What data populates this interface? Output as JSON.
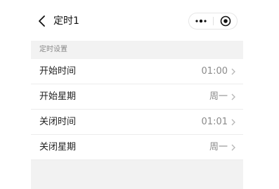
{
  "header": {
    "title": "定时1",
    "back_icon": "chevron-left-icon",
    "more_icon": "more-dots-icon",
    "close_icon": "target-circle-icon"
  },
  "section": {
    "label": "定时设置"
  },
  "settings": [
    {
      "label": "开始时间",
      "value": "01:00"
    },
    {
      "label": "开始星期",
      "value": "周一"
    },
    {
      "label": "关闭时间",
      "value": "01:01"
    },
    {
      "label": "关闭星期",
      "value": "周一"
    }
  ],
  "colors": {
    "background": "#f2f2f2",
    "card": "#ffffff",
    "text_primary": "#222222",
    "text_secondary": "#8a8a8a"
  }
}
